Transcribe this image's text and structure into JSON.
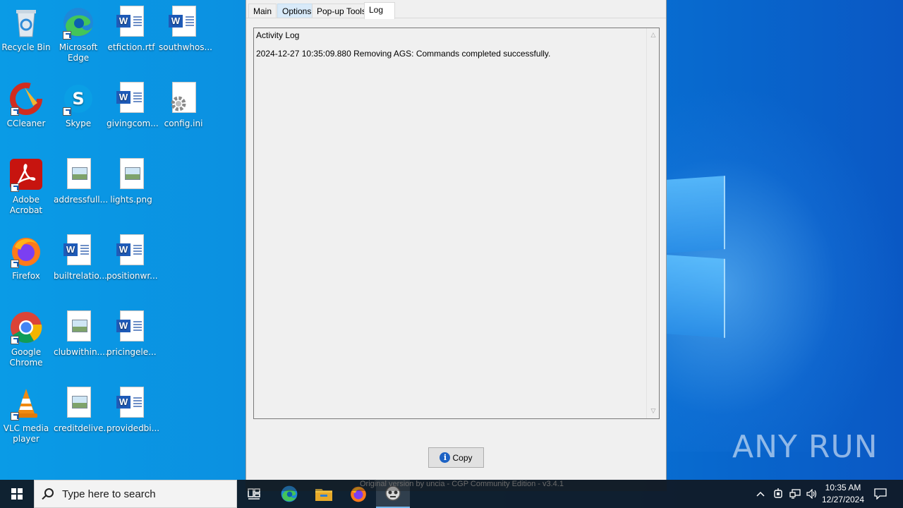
{
  "desktop": {
    "icons": [
      {
        "label": "Recycle Bin"
      },
      {
        "label": "Microsoft Edge"
      },
      {
        "label": "etfiction.rtf"
      },
      {
        "label": "southwhos..."
      },
      {
        "label": "CCleaner"
      },
      {
        "label": "Skype"
      },
      {
        "label": "givingcom..."
      },
      {
        "label": "config.ini"
      },
      {
        "label": "Adobe Acrobat"
      },
      {
        "label": "addressfull..."
      },
      {
        "label": "lights.png"
      },
      {
        "label": "Firefox"
      },
      {
        "label": "builtrelatio..."
      },
      {
        "label": "positionwr..."
      },
      {
        "label": "Google Chrome"
      },
      {
        "label": "clubwithin...."
      },
      {
        "label": "pricingele..."
      },
      {
        "label": "VLC media player"
      },
      {
        "label": "creditdelive..."
      },
      {
        "label": "providedbi..."
      }
    ]
  },
  "app": {
    "tabs": [
      {
        "label": "Main"
      },
      {
        "label": "Options"
      },
      {
        "label": "Pop-up Tools"
      },
      {
        "label": "Log"
      }
    ],
    "selected_tab": "Log",
    "log": {
      "title": "Activity Log",
      "entries": [
        "2024-12-27 10:35:09.880 Removing AGS: Commands completed successfully."
      ]
    },
    "copy_button_label": "Copy",
    "status_text": "Original version by uncia - CGP Community Edition - v3.4.1"
  },
  "taskbar": {
    "search_placeholder": "Type here to search",
    "pinned": [
      "task-view-icon",
      "edge-icon",
      "file-explorer-icon",
      "firefox-icon",
      "cleaner-app-icon"
    ],
    "clock_time": "10:35 AM",
    "clock_date": "12/27/2024"
  },
  "watermark": "ANY RUN",
  "colors": {
    "taskbar": "#101822",
    "accent": "#76b9ed",
    "word_blue": "#1f5bb8"
  }
}
